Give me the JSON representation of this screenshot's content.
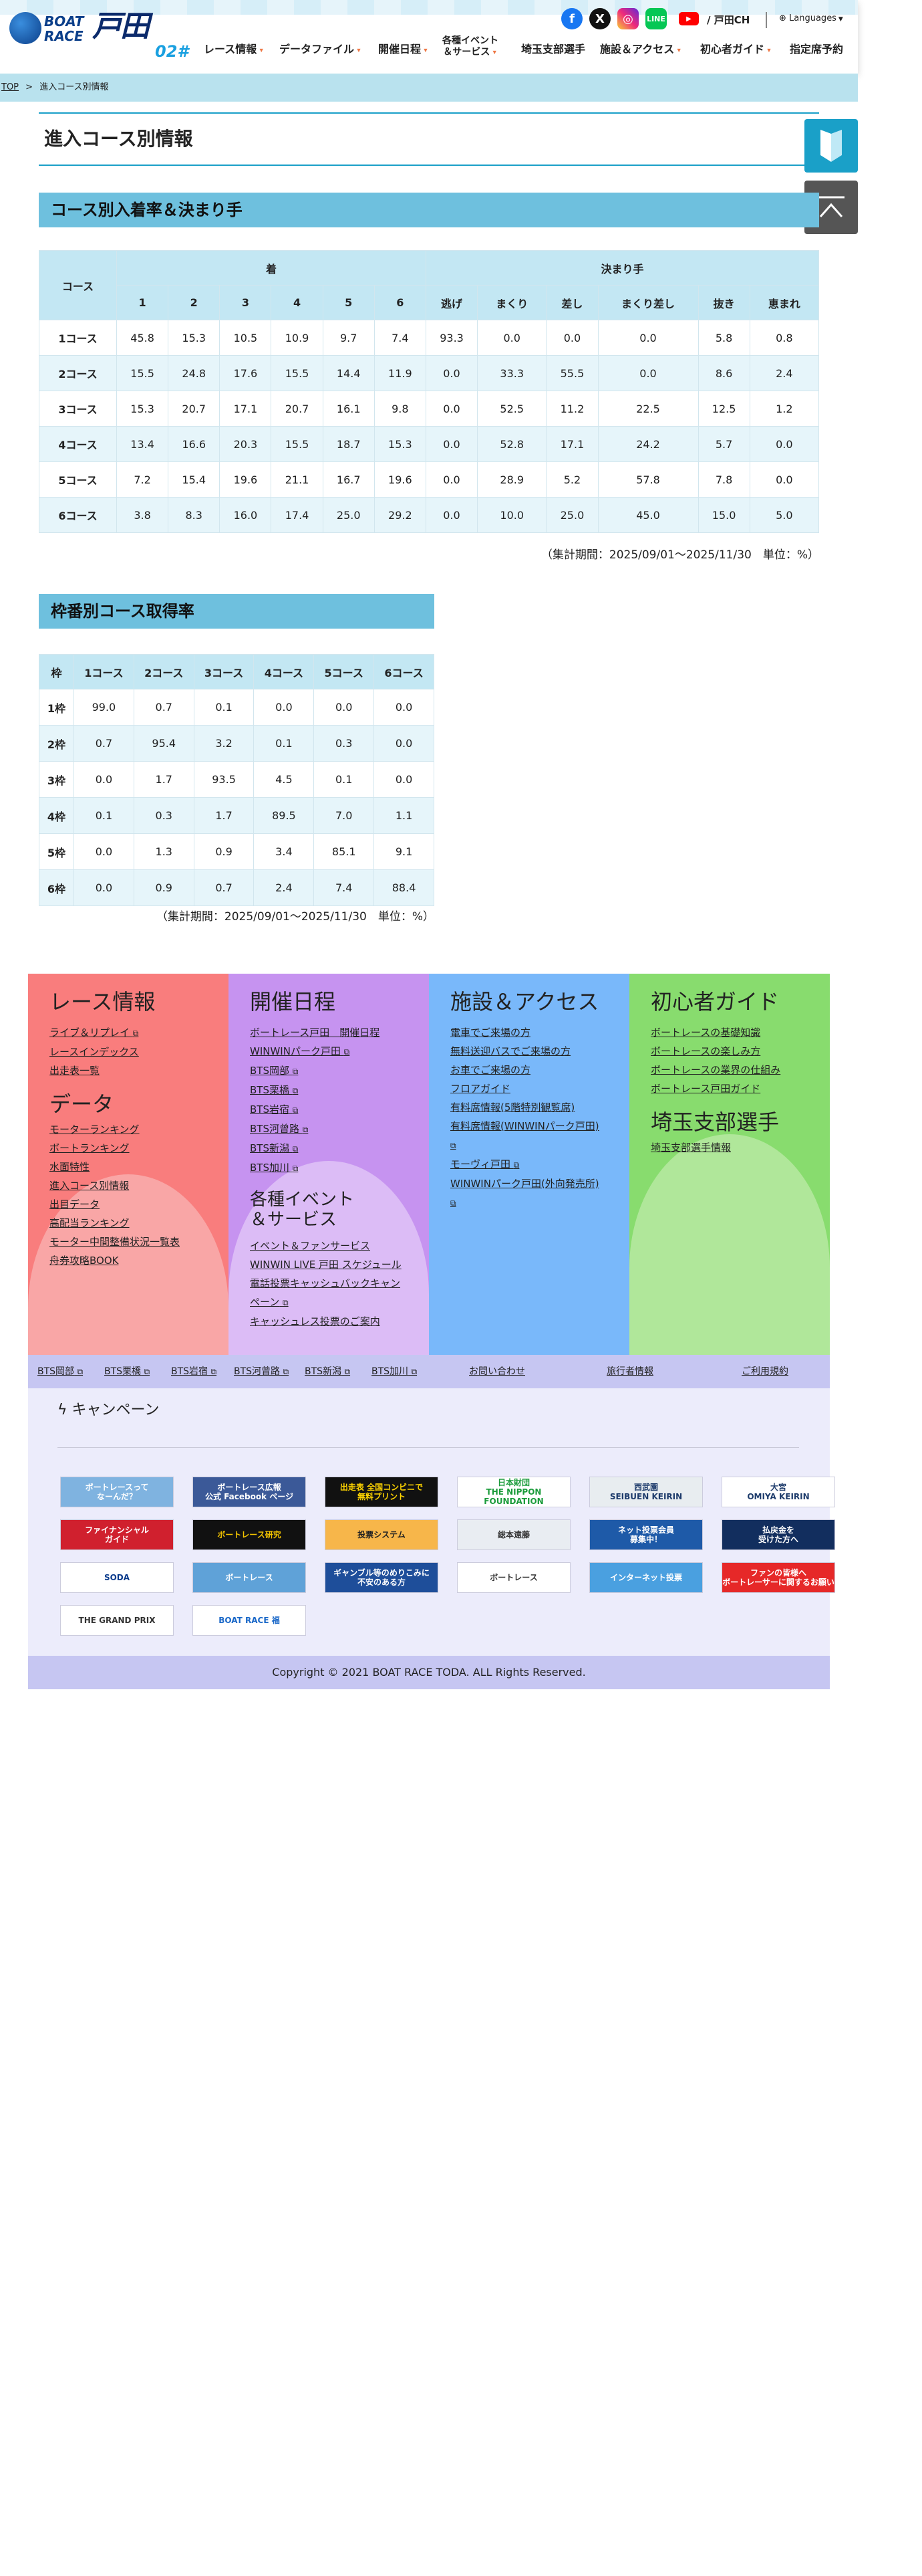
{
  "header": {
    "logo_boat": "BOAT",
    "logo_race": "RACE",
    "logo_name": "戸田",
    "logo_num": "02#",
    "toda_ch": "/ 戸田CH",
    "languages": "Languages",
    "nav": [
      "レース情報",
      "データファイル",
      "開催日程",
      "各種イベント",
      "＆サービス",
      "埼玉支部選手",
      "施設＆アクセス",
      "初心者ガイド",
      "指定席予約"
    ]
  },
  "breadcrumb": {
    "top": "TOP",
    "sep": ">",
    "current": "進入コース別情報"
  },
  "page_title": "進入コース別情報",
  "table1": {
    "title": "コース別入着率＆決まり手",
    "col_course": "コース",
    "group_chaku": "着",
    "group_kimarite": "決まり手",
    "headers": [
      "1",
      "2",
      "3",
      "4",
      "5",
      "6",
      "逃げ",
      "まくり",
      "差し",
      "まくり差し",
      "抜き",
      "恵まれ"
    ],
    "rows": [
      {
        "label": "1コース",
        "values": [
          "45.8",
          "15.3",
          "10.5",
          "10.9",
          "9.7",
          "7.4",
          "93.3",
          "0.0",
          "0.0",
          "0.0",
          "5.8",
          "0.8"
        ]
      },
      {
        "label": "2コース",
        "values": [
          "15.5",
          "24.8",
          "17.6",
          "15.5",
          "14.4",
          "11.9",
          "0.0",
          "33.3",
          "55.5",
          "0.0",
          "8.6",
          "2.4"
        ]
      },
      {
        "label": "3コース",
        "values": [
          "15.3",
          "20.7",
          "17.1",
          "20.7",
          "16.1",
          "9.8",
          "0.0",
          "52.5",
          "11.2",
          "22.5",
          "12.5",
          "1.2"
        ]
      },
      {
        "label": "4コース",
        "values": [
          "13.4",
          "16.6",
          "20.3",
          "15.5",
          "18.7",
          "15.3",
          "0.0",
          "52.8",
          "17.1",
          "24.2",
          "5.7",
          "0.0"
        ]
      },
      {
        "label": "5コース",
        "values": [
          "7.2",
          "15.4",
          "19.6",
          "21.1",
          "16.7",
          "19.6",
          "0.0",
          "28.9",
          "5.2",
          "57.8",
          "7.8",
          "0.0"
        ]
      },
      {
        "label": "6コース",
        "values": [
          "3.8",
          "8.3",
          "16.0",
          "17.4",
          "25.0",
          "29.2",
          "0.0",
          "10.0",
          "25.0",
          "45.0",
          "15.0",
          "5.0"
        ]
      }
    ],
    "note": "（集計期間：2025/09/01～2025/11/30　単位：%）"
  },
  "table2": {
    "title": "枠番別コース取得率",
    "headers": [
      "枠",
      "1コース",
      "2コース",
      "3コース",
      "4コース",
      "5コース",
      "6コース"
    ],
    "rows": [
      {
        "label": "1枠",
        "values": [
          "99.0",
          "0.7",
          "0.1",
          "0.0",
          "0.0",
          "0.0"
        ]
      },
      {
        "label": "2枠",
        "values": [
          "0.7",
          "95.4",
          "3.2",
          "0.1",
          "0.3",
          "0.0"
        ]
      },
      {
        "label": "3枠",
        "values": [
          "0.0",
          "1.7",
          "93.5",
          "4.5",
          "0.1",
          "0.0"
        ]
      },
      {
        "label": "4枠",
        "values": [
          "0.1",
          "0.3",
          "1.7",
          "89.5",
          "7.0",
          "1.1"
        ]
      },
      {
        "label": "5枠",
        "values": [
          "0.0",
          "1.3",
          "0.9",
          "3.4",
          "85.1",
          "9.1"
        ]
      },
      {
        "label": "6枠",
        "values": [
          "0.0",
          "0.9",
          "0.7",
          "2.4",
          "7.4",
          "88.4"
        ]
      }
    ],
    "note": "（集計期間：2025/09/01～2025/11/30　単位：%）"
  },
  "footer": {
    "race_info": {
      "title": "レース情報",
      "links": [
        "ライブ＆リプレイ",
        "レースインデックス",
        "出走表一覧"
      ]
    },
    "data": {
      "title": "データ",
      "links": [
        "モーターランキング",
        "ボートランキング",
        "水面特性",
        "進入コース別情報",
        "出目データ",
        "高配当ランキング",
        "モーター中間整備状況一覧表",
        "舟券攻略BOOK"
      ]
    },
    "schedule": {
      "title": "開催日程",
      "links": [
        "ボートレース戸田　開催日程",
        "WINWINパーク戸田",
        "BTS岡部",
        "BTS栗橋",
        "BTS岩宿",
        "BTS河曾路",
        "BTS新潟",
        "BTS加川"
      ]
    },
    "events": {
      "title1": "各種イベント",
      "title2": "＆サービス",
      "links": [
        "イベント＆ファンサービス",
        "WINWIN LIVE 戸田 スケジュール",
        "電話投票キャッシュバックキャン",
        "ペーン",
        "キャッシュレス投票のご案内"
      ]
    },
    "access": {
      "title": "施設＆アクセス",
      "links": [
        "電車でご来場の方",
        "無料送迎バスでご来場の方",
        "お車でご来場の方",
        "フロアガイド",
        "有料席情報(5階特別観覧席)",
        "有料席情報(WINWINパーク戸田)",
        "",
        "モーヴィ戸田",
        "WINWINパーク戸田(外向発売所)"
      ]
    },
    "beginner": {
      "title": "初心者ガイド",
      "links": [
        "ボートレースの基礎知識",
        "ボートレースの楽しみ方",
        "ボートレースの業界の仕組み",
        "ボートレース戸田ガイド"
      ]
    },
    "players": {
      "title": "埼玉支部選手",
      "links": [
        "埼玉支部選手情報"
      ]
    },
    "subbar": [
      "BTS岡部",
      "BTS栗橋",
      "BTS岩宿",
      "BTS河曾路",
      "BTS新潟",
      "BTS加川",
      "お問い合わせ",
      "旅行者情報",
      "ご利用規約"
    ],
    "campaign_title": "キャンペーン",
    "banners": [
      "ボートレースって\nなーんだ？",
      "ボートレース広報\n公式 Facebook ページ",
      "出走表 全国コンビニで\n無料プリント",
      "日本財団\nTHE NIPPON FOUNDATION",
      "西武園\nSEIBUEN KEIRIN",
      "大宮\nOMIYA KEIRIN",
      "ファイナンシャル\nガイド",
      "ボートレース研究",
      "投票システム",
      "総本遠藤",
      "ネット投票会員\n募集中！",
      "払戻金を\n受けた方へ",
      "SODA",
      "ボートレース",
      "ギャンブル等のめりこみに\n不安のある方",
      "ボートレース",
      "インターネット投票",
      "ファンの皆様へ\nボートレーサーに関するお願い",
      "THE GRAND PRIX",
      "BOAT RACE 福"
    ],
    "copyright": "Copyright © 2021 BOAT RACE TODA. ALL Rights Reserved."
  },
  "colors": {
    "race": "#f97d7d",
    "schedule": "#c693f0",
    "access": "#79b8fa",
    "beginner": "#88dc6e",
    "section_head": "#6ec0de",
    "table_head": "#c3e7f3",
    "row_alt": "#e6f5fa"
  }
}
